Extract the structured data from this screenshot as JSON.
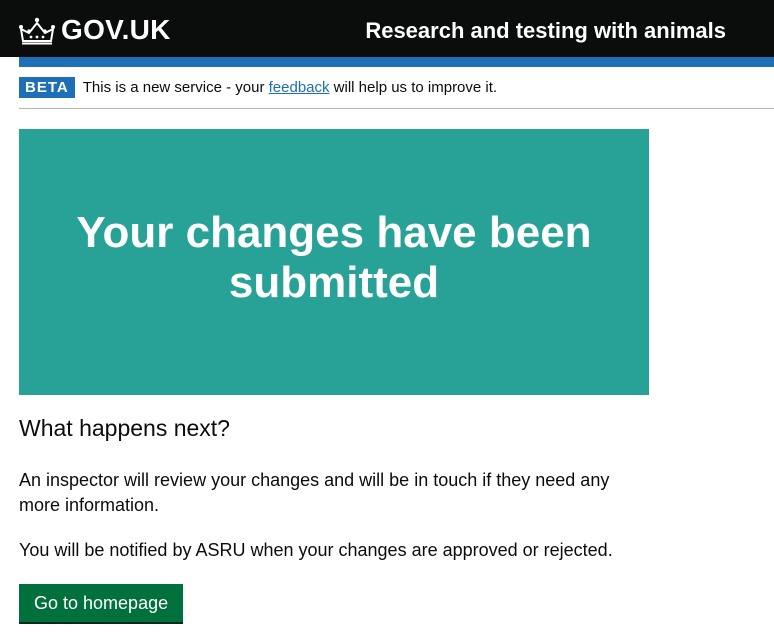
{
  "header": {
    "logo_text": "GOV.UK",
    "service_name": "Research and testing with animals"
  },
  "phase_banner": {
    "tag": "BETA",
    "text_before": "This is a new service - your ",
    "link_text": "feedback",
    "text_after": " will help us to improve it."
  },
  "panel": {
    "title": "Your changes have been submitted"
  },
  "content": {
    "heading": "What happens next?",
    "paragraph_1": "An inspector will review your changes and will be in touch if they need any more information.",
    "paragraph_2": "You will be notified by ASRU when your changes are approved or rejected."
  },
  "actions": {
    "homepage_button": "Go to homepage"
  },
  "colors": {
    "header_bg": "#0b0c0c",
    "brand_blue": "#1d70b8",
    "panel_turquoise": "#28a197",
    "button_green": "#00703c"
  }
}
